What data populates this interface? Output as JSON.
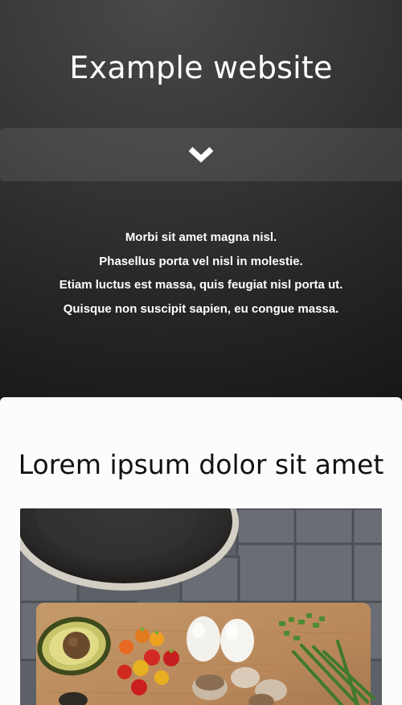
{
  "header": {
    "site_title": "Example website",
    "nav_toggle_icon": "chevron-down-icon"
  },
  "intro": {
    "lines": [
      "Morbi sit amet magna nisl.",
      "Phasellus porta vel nisl in molestie.",
      "Etiam luctus est massa, quis feugiat nisl porta ut.",
      "Quisque non suscipit sapien, eu congue massa."
    ]
  },
  "content": {
    "heading": "Lorem ipsum dolor sit amet"
  },
  "colors": {
    "hero_dark": "#141313",
    "hero_light": "#4a4949",
    "content_bg": "#fcfcfc",
    "text_light": "#ffffff",
    "text_dark": "#111111"
  }
}
